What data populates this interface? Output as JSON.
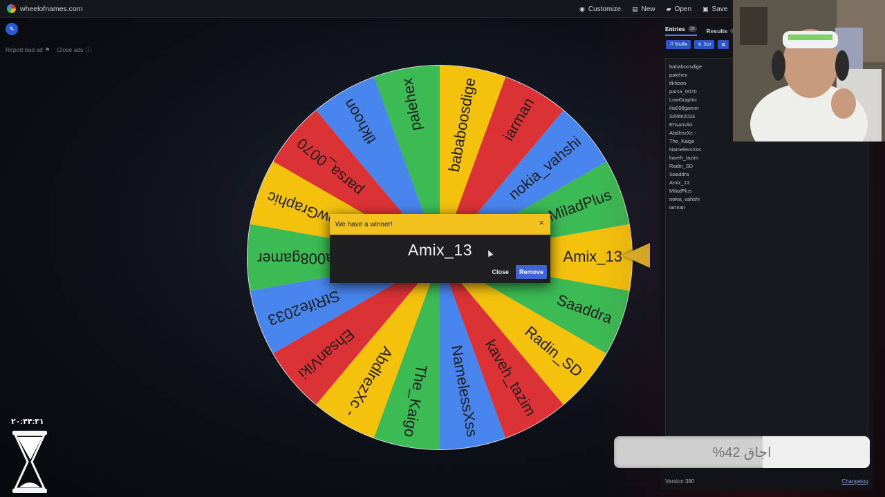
{
  "topbar": {
    "site": "wheelofnames.com",
    "nav": [
      {
        "label": "Customize",
        "icon": "palette-icon"
      },
      {
        "label": "New",
        "icon": "file-icon"
      },
      {
        "label": "Open",
        "icon": "folder-icon"
      },
      {
        "label": "Save",
        "icon": "save-icon"
      }
    ]
  },
  "ads": {
    "report": "Report bad ad",
    "close": "Close ads"
  },
  "wheel": {
    "segments": [
      "Amix_13",
      "MiladPlus",
      "nokia_vahshi",
      "iarman",
      "bababoosdige",
      "palehex",
      "tlkhoon",
      "parsa_0070",
      "LowGraphic",
      "ilia008gamer",
      "StRife2033",
      "EhsanViki",
      "AbdlrezXc -",
      "The_Kaigo",
      "NamelessXss",
      "kaveh_tazim",
      "Radin_SD",
      "Saaddra"
    ],
    "colors": [
      "#f4c20d",
      "#3cba54",
      "#4885ed",
      "#db3236"
    ]
  },
  "dialog": {
    "title": "We have a winner!",
    "winner": "Amix_13",
    "close_label": "Close",
    "remove_label": "Remove",
    "x_label": "×"
  },
  "panel": {
    "tabs": [
      {
        "label": "Entries",
        "count": "18"
      },
      {
        "label": "Results",
        "count": "46"
      }
    ],
    "tools": [
      "Shuffle",
      "Sort"
    ],
    "entries": [
      "bababoosdige",
      "palehex",
      "tlkhoon",
      "parsa_0070",
      "LowGraphic",
      "ilia008gamer",
      "StRife2033",
      "EhsanViki",
      "AbdlrezXc -",
      "The_Kaigo",
      "NamelessXss",
      "kaveh_tazim",
      "Radin_SD",
      "Saaddra",
      "Amix_13",
      "MiladPlus",
      "nokia_vahshi",
      "iarman"
    ],
    "version": "Version 380",
    "changelog": "Changelog"
  },
  "overlay": {
    "progress_text": "اجاق 42%",
    "progress": 0.42,
    "clock": "۲۰:۴۴:۳۱"
  }
}
